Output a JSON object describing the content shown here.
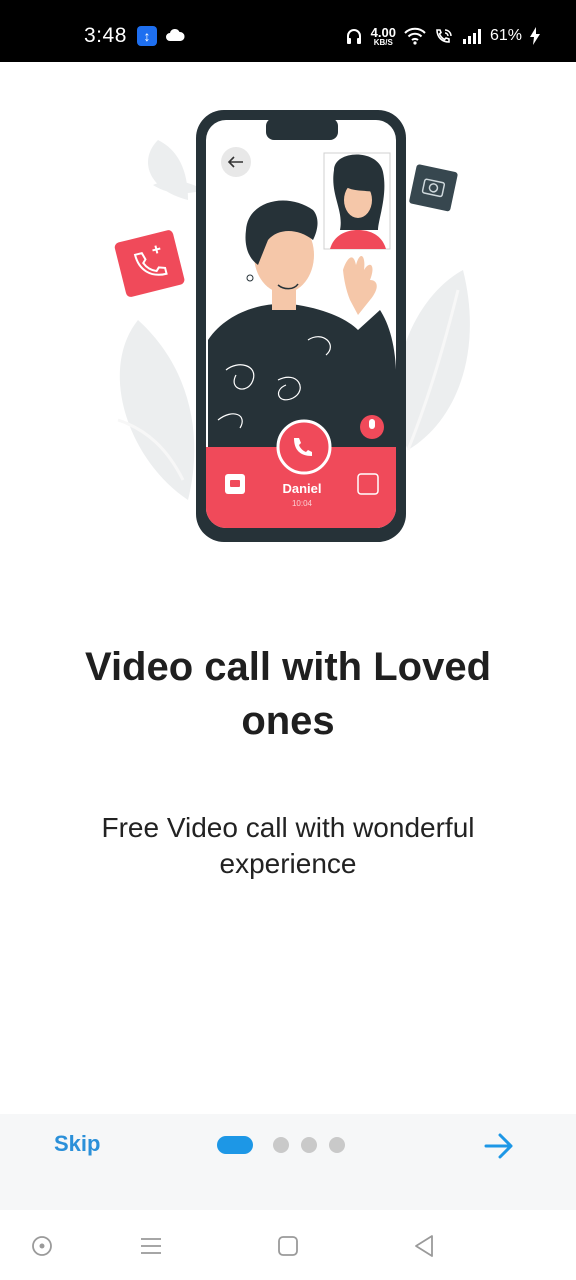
{
  "status_bar": {
    "time": "3:48",
    "net_speed_value": "4.00",
    "net_speed_unit": "KB/S",
    "battery": "61%"
  },
  "illustration": {
    "caller_name": "Daniel",
    "call_time": "10:04"
  },
  "onboarding": {
    "title": "Video call with Loved ones",
    "subtitle": "Free Video call with wonderful experience",
    "skip_label": "Skip",
    "page_count": 4,
    "active_page": 1
  },
  "colors": {
    "accent": "#1d97e6",
    "call_red": "#f04a5a",
    "phone_frame": "#263238"
  }
}
